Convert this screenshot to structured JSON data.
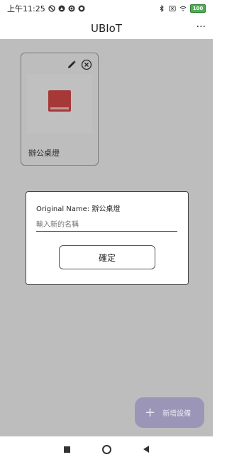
{
  "status_bar": {
    "time": "上午11:25",
    "battery": "100"
  },
  "app_bar": {
    "title": "UBIoT",
    "more_label": "···"
  },
  "device_card": {
    "name": "辦公桌燈"
  },
  "rename_dialog": {
    "original_name_label": "Original Name: 辦公桌燈",
    "input_placeholder": "輸入新的名稱",
    "input_value": "",
    "confirm_label": "確定"
  },
  "fab": {
    "plus": "+",
    "label": "新增設備"
  },
  "colors": {
    "fab_background": "#9b96b8",
    "relay_red": "#d64848",
    "battery_green": "#4caf50"
  }
}
